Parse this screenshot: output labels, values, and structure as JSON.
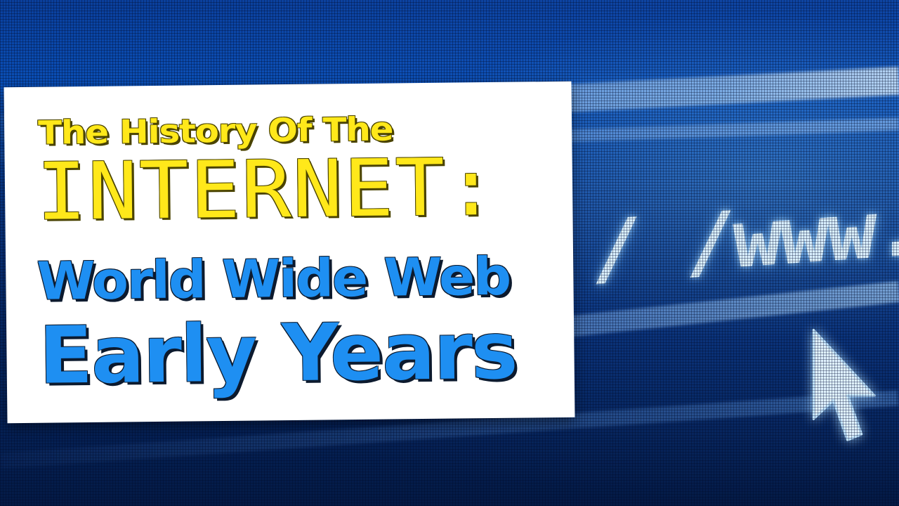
{
  "title": {
    "line1": "The History Of The",
    "line2": "INTERNET:",
    "line3": "World Wide Web",
    "line4": "Early Years"
  },
  "background": {
    "url_text": "/ /www.",
    "cursor_icon": "mouse-pointer-icon"
  },
  "colors": {
    "title_yellow": "#ffe81a",
    "title_blue": "#1e8ff2",
    "card": "#ffffff",
    "background": "#0a3f9c"
  }
}
